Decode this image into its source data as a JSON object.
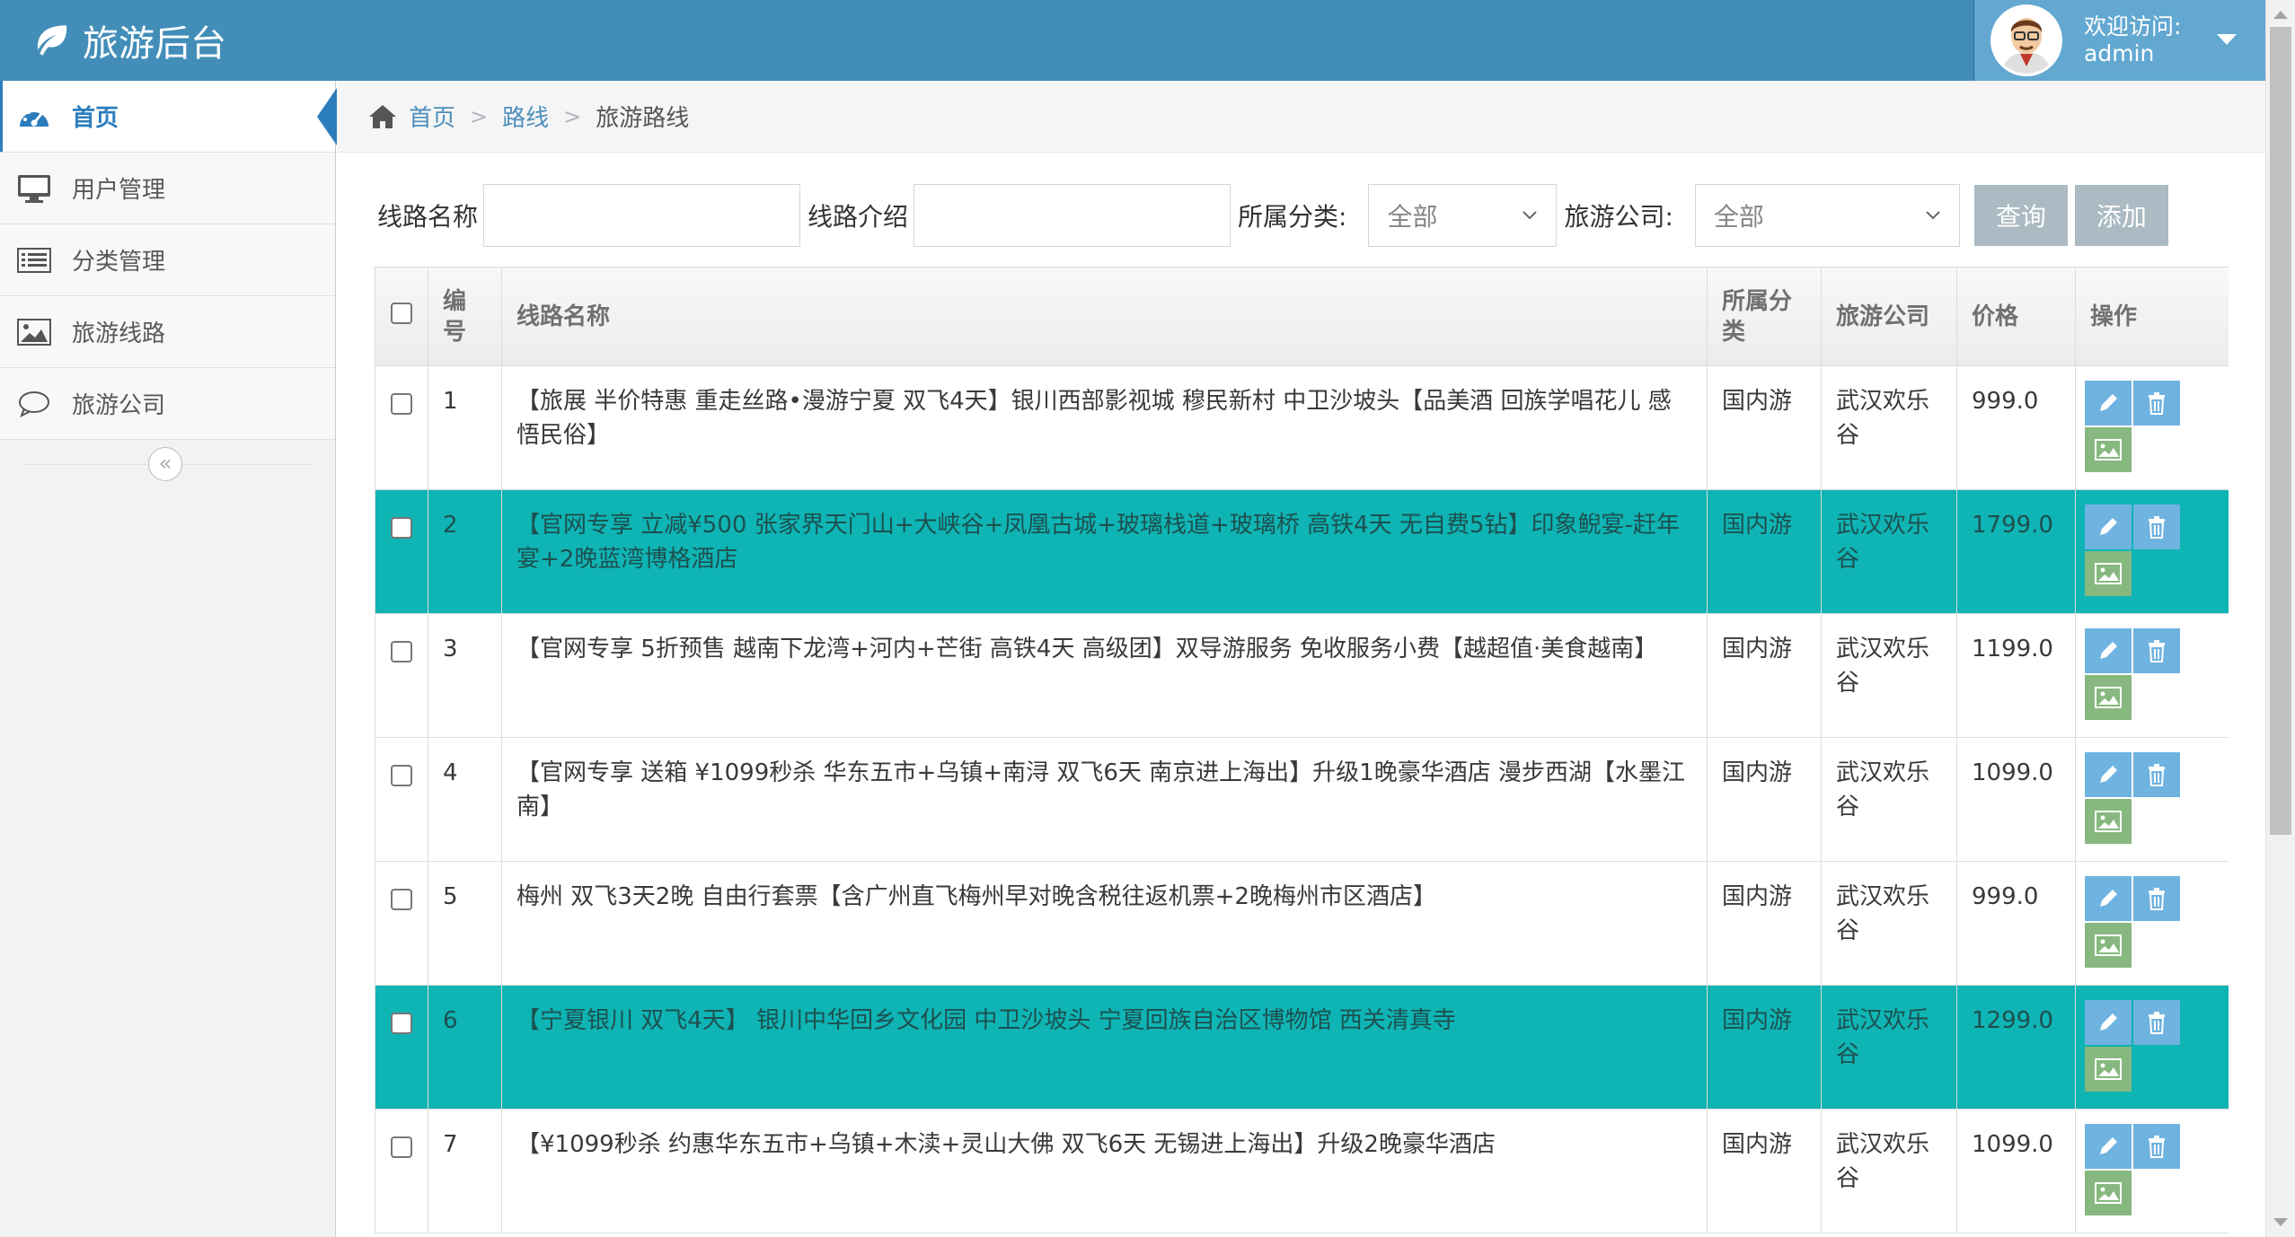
{
  "header": {
    "brand_title": "旅游后台",
    "greeting": "欢迎访问:",
    "username": "admin"
  },
  "sidebar": {
    "items": [
      {
        "label": "首页",
        "icon": "dashboard-icon"
      },
      {
        "label": "用户管理",
        "icon": "monitor-icon"
      },
      {
        "label": "分类管理",
        "icon": "list-icon"
      },
      {
        "label": "旅游线路",
        "icon": "picture-icon"
      },
      {
        "label": "旅游公司",
        "icon": "comment-icon"
      }
    ],
    "collapse_glyph": "«"
  },
  "breadcrumb": {
    "home": "首页",
    "routes": "路线",
    "current": "旅游路线",
    "sep": ">"
  },
  "filters": {
    "route_name_label": "线路名称",
    "route_intro_label": "线路介绍",
    "category_label": "所属分类:",
    "category_value": "全部",
    "company_label": "旅游公司:",
    "company_value": "全部",
    "query_button": "查询",
    "add_button": "添加"
  },
  "table": {
    "headers": {
      "id": "编号",
      "name": "线路名称",
      "category": "所属分类",
      "company": "旅游公司",
      "price": "价格",
      "ops": "操作"
    },
    "rows": [
      {
        "id": "1",
        "name": "【旅展 半价特惠 重走丝路•漫游宁夏 双飞4天】银川西部影视城 穆民新村 中卫沙坡头【品美酒 回族学唱花儿 感悟民俗】",
        "category": "国内游",
        "company": "武汉欢乐谷",
        "price": "999.0"
      },
      {
        "id": "2",
        "name": "【官网专享 立减¥500 张家界天门山+大峡谷+凤凰古城+玻璃栈道+玻璃桥 高铁4天 无自费5钻】印象鲵宴-赶年宴+2晚蓝湾博格酒店",
        "category": "国内游",
        "company": "武汉欢乐谷",
        "price": "1799.0"
      },
      {
        "id": "3",
        "name": "【官网专享 5折预售 越南下龙湾+河内+芒街 高铁4天 高级团】双导游服务 免收服务小费【越超值·美食越南】",
        "category": "国内游",
        "company": "武汉欢乐谷",
        "price": "1199.0"
      },
      {
        "id": "4",
        "name": "【官网专享 送箱 ¥1099秒杀 华东五市+乌镇+南浔 双飞6天 南京进上海出】升级1晚豪华酒店 漫步西湖【水墨江南】",
        "category": "国内游",
        "company": "武汉欢乐谷",
        "price": "1099.0"
      },
      {
        "id": "5",
        "name": "梅州 双飞3天2晚 自由行套票【含广州直飞梅州早对晚含税往返机票+2晚梅州市区酒店】",
        "category": "国内游",
        "company": "武汉欢乐谷",
        "price": "999.0"
      },
      {
        "id": "6",
        "name": "【宁夏银川 双飞4天】 银川中华回乡文化园 中卫沙坡头 宁夏回族自治区博物馆 西关清真寺",
        "category": "国内游",
        "company": "武汉欢乐谷",
        "price": "1299.0"
      },
      {
        "id": "7",
        "name": "【¥1099秒杀 约惠华东五市+乌镇+木渎+灵山大佛 双飞6天 无锡进上海出】升级2晚豪华酒店",
        "category": "国内游",
        "company": "武汉欢乐谷",
        "price": "1099.0"
      }
    ]
  },
  "colors": {
    "header_bg": "#438eb9",
    "user_box_bg": "#62a8d1",
    "highlight_row": "#0fb4b4",
    "edit_button": "#6fb3e0",
    "image_button": "#87b87f",
    "button_gray": "#abbac3"
  }
}
